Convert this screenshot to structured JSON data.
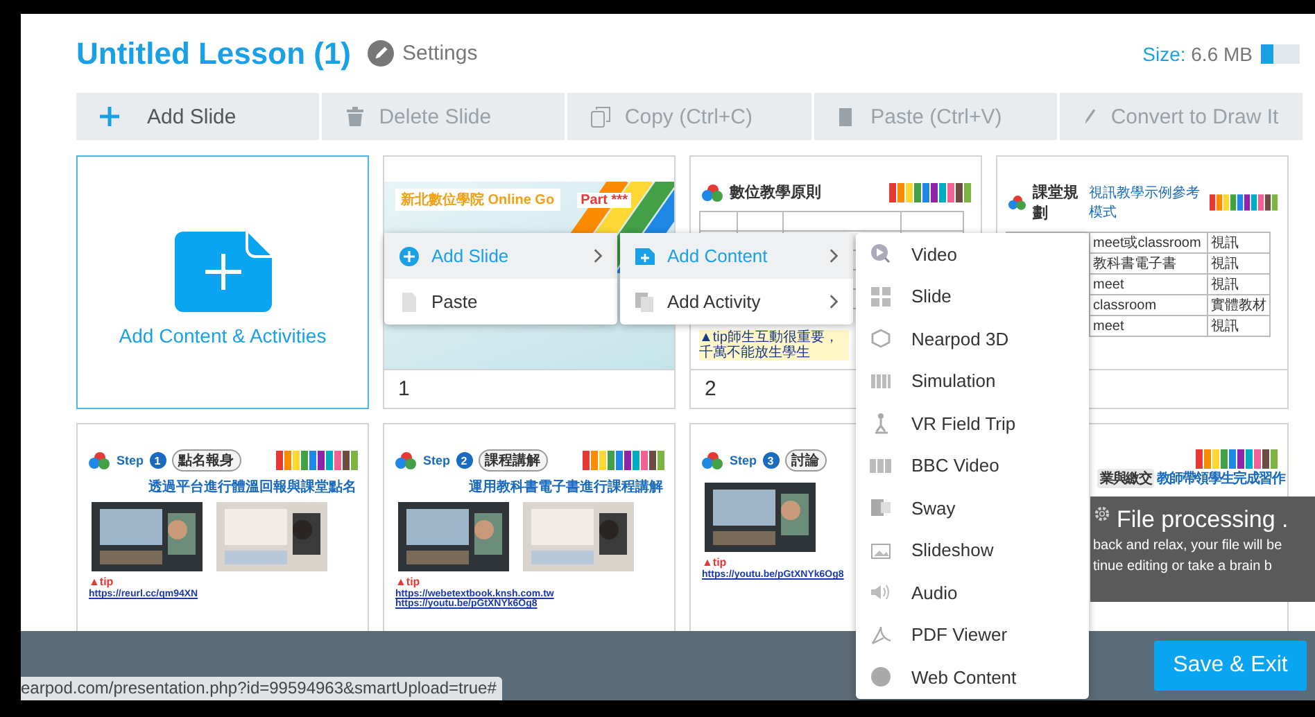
{
  "lesson": {
    "title": "Untitled Lesson (1)",
    "settings": "Settings",
    "size_label": "Size:",
    "size_value": "6.6 MB",
    "level": 0.33
  },
  "toolbar": [
    {
      "label": "Add Slide",
      "disabled": false
    },
    {
      "label": "Delete Slide",
      "disabled": true
    },
    {
      "label": "Copy (Ctrl+C)",
      "disabled": true
    },
    {
      "label": "Paste (Ctrl+V)",
      "disabled": true
    },
    {
      "label": "Convert to Draw It",
      "disabled": true
    }
  ],
  "add_tile": {
    "label": "Add Content & Activities"
  },
  "slides": [
    {
      "kind": "cover",
      "number": "1",
      "title": "新北數位學院 Online Go",
      "subtitle": "Part ***"
    },
    {
      "kind": "table",
      "number": "2",
      "title": "數位教學原則",
      "tip": "▲tip師生互動很重要，千萬不能放生學生"
    },
    {
      "kind": "table",
      "title": "課堂規劃",
      "subtitle": "視訊教學示例參考模式",
      "rows": [
        [
          "meet或classroom",
          "視訊"
        ],
        [
          "教科書電子書",
          "視訊"
        ],
        [
          "meet",
          "視訊"
        ],
        [
          "classroom",
          "實體教材"
        ],
        [
          "meet",
          "視訊"
        ]
      ]
    },
    {
      "kind": "step",
      "step": "Step",
      "step_number": "1",
      "badge": "點名報身",
      "headline": "透過平台進行體溫回報與課堂點名",
      "tip": "▲tip",
      "links": [
        "https://reurl.cc/qm94XN"
      ]
    },
    {
      "kind": "step",
      "step": "Step",
      "step_number": "2",
      "badge": "課程講解",
      "headline": "運用教科書電子書進行課程講解",
      "tip": "▲tip",
      "links": [
        "https://webetextbook.knsh.com.tw",
        "https://youtu.be/pGtXNYk6Og8"
      ]
    },
    {
      "kind": "step",
      "step": "Step",
      "step_number": "3",
      "badge": "討論",
      "tip": "▲tip",
      "links": [
        "https://youtu.be/pGtXNYk6Og8"
      ]
    },
    {
      "kind": "step",
      "badge": "業與繳交",
      "headline": "教師帶領學生完成習作"
    }
  ],
  "menus": [
    [
      {
        "label": "Add Slide",
        "submenu": true,
        "selected": true
      },
      {
        "label": "Paste",
        "submenu": false,
        "selected": false
      }
    ],
    [
      {
        "label": "Add Content",
        "submenu": true,
        "selected": true
      },
      {
        "label": "Add Activity",
        "submenu": true,
        "selected": false
      }
    ],
    [
      {
        "label": "Video",
        "submenu": false,
        "selected": false
      },
      {
        "label": "Slide",
        "submenu": false,
        "selected": false
      },
      {
        "label": "Nearpod 3D",
        "submenu": false,
        "selected": false
      },
      {
        "label": "Simulation",
        "submenu": false,
        "selected": false
      },
      {
        "label": "VR Field Trip",
        "submenu": false,
        "selected": false
      },
      {
        "label": "BBC Video",
        "submenu": false,
        "selected": false
      },
      {
        "label": "Sway",
        "submenu": false,
        "selected": false
      },
      {
        "label": "Slideshow",
        "submenu": false,
        "selected": false
      },
      {
        "label": "Audio",
        "submenu": false,
        "selected": false
      },
      {
        "label": "PDF Viewer",
        "submenu": false,
        "selected": false
      },
      {
        "label": "Web Content",
        "submenu": false,
        "selected": false
      }
    ]
  ],
  "processing": {
    "title": "File processing .",
    "lines": [
      "back and relax, your file will be",
      "tinue editing or take a brain b"
    ]
  },
  "save_button": "Save & Exit",
  "status_url": "earpod.com/presentation.php?id=99594963&smartUpload=true#"
}
